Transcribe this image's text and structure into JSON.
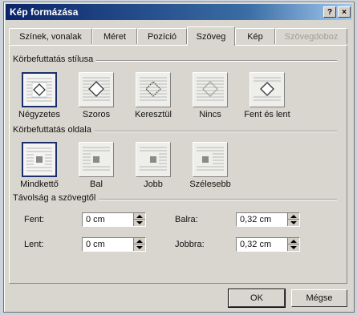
{
  "window": {
    "title": "Kép formázása",
    "help_label": "?",
    "close_label": "×"
  },
  "tabs": [
    {
      "label": "Színek, vonalak"
    },
    {
      "label": "Méret"
    },
    {
      "label": "Pozíció"
    },
    {
      "label": "Szöveg",
      "active": true
    },
    {
      "label": "Kép"
    },
    {
      "label": "Szövegdoboz",
      "disabled": true
    }
  ],
  "wrap_style": {
    "title": "Körbefuttatás stílusa",
    "options": [
      {
        "label": "Négyzetes",
        "selected": true,
        "icon": "square-wrap-icon"
      },
      {
        "label": "Szoros",
        "icon": "tight-wrap-icon"
      },
      {
        "label": "Keresztül",
        "icon": "through-wrap-icon"
      },
      {
        "label": "Nincs",
        "icon": "no-wrap-icon"
      },
      {
        "label": "Fent és lent",
        "icon": "top-bottom-wrap-icon"
      }
    ]
  },
  "wrap_side": {
    "title": "Körbefuttatás oldala",
    "options": [
      {
        "label": "Mindkettő",
        "selected": true,
        "icon": "both-sides-icon"
      },
      {
        "label": "Bal",
        "icon": "left-side-icon"
      },
      {
        "label": "Jobb",
        "icon": "right-side-icon"
      },
      {
        "label": "Szélesebb",
        "icon": "largest-side-icon"
      }
    ]
  },
  "distance": {
    "title": "Távolság a szövegtől",
    "top_label": "Fent:",
    "top_value": "0 cm",
    "bottom_label": "Lent:",
    "bottom_value": "0 cm",
    "left_label": "Balra:",
    "left_value": "0,32 cm",
    "right_label": "Jobbra:",
    "right_value": "0,32 cm"
  },
  "buttons": {
    "ok": "OK",
    "cancel": "Mégse"
  }
}
